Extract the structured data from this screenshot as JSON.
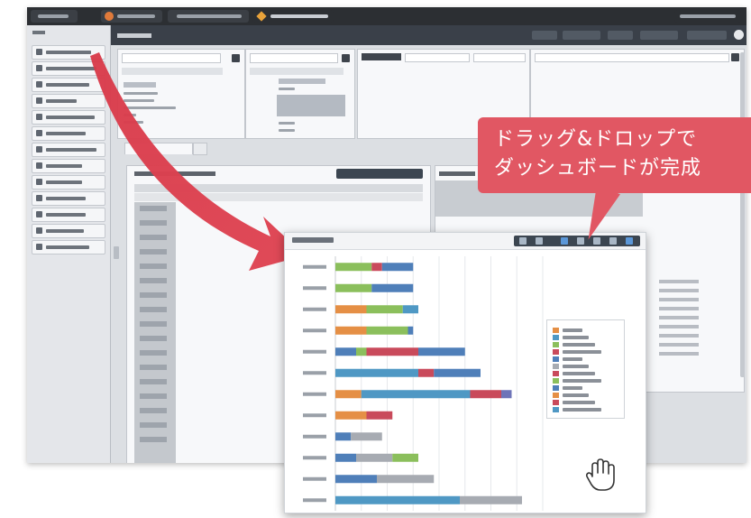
{
  "callout": {
    "line1": "ドラッグ&ドロップで",
    "line2": "ダッシュボードが完成"
  },
  "sidebar": {
    "items": [
      {
        "icon": "chart-icon"
      },
      {
        "icon": "chart-icon"
      },
      {
        "icon": "gauge-icon"
      },
      {
        "icon": "table-icon"
      },
      {
        "icon": "filter-icon"
      },
      {
        "icon": "sort-icon"
      },
      {
        "icon": "grid-icon"
      },
      {
        "icon": "pin-icon"
      },
      {
        "icon": "pie-icon"
      },
      {
        "icon": "line-icon"
      },
      {
        "icon": "line-icon"
      },
      {
        "icon": "link-icon"
      },
      {
        "icon": "map-icon"
      }
    ]
  },
  "colors": {
    "accent": "#e15763",
    "green": "#8bbf5c",
    "red": "#c94a5b",
    "blue": "#4f7fb9",
    "orange": "#e58f45",
    "gray": "#a7abb2",
    "teal": "#4f98c4",
    "purple": "#6e74b8"
  },
  "chart_data": {
    "type": "bar",
    "orientation": "horizontal",
    "stacked": true,
    "x_ticks": [
      "0",
      "5",
      "10",
      "15",
      "20",
      "25",
      "30",
      "35",
      "40"
    ],
    "xlim": [
      0,
      40
    ],
    "grid": true,
    "legend_position": "right",
    "rows": [
      {
        "segments": [
          {
            "color": "green",
            "value": 7
          },
          {
            "color": "red",
            "value": 2
          },
          {
            "color": "blue",
            "value": 6
          }
        ]
      },
      {
        "segments": [
          {
            "color": "green",
            "value": 7
          },
          {
            "color": "blue",
            "value": 8
          }
        ]
      },
      {
        "segments": [
          {
            "color": "orange",
            "value": 6
          },
          {
            "color": "green",
            "value": 7
          },
          {
            "color": "teal",
            "value": 3
          }
        ]
      },
      {
        "segments": [
          {
            "color": "orange",
            "value": 6
          },
          {
            "color": "green",
            "value": 8
          },
          {
            "color": "blue",
            "value": 1
          }
        ]
      },
      {
        "segments": [
          {
            "color": "blue",
            "value": 4
          },
          {
            "color": "green",
            "value": 2
          },
          {
            "color": "red",
            "value": 10
          },
          {
            "color": "blue",
            "value": 9
          }
        ]
      },
      {
        "segments": [
          {
            "color": "teal",
            "value": 16
          },
          {
            "color": "red",
            "value": 3
          },
          {
            "color": "blue",
            "value": 9
          }
        ]
      },
      {
        "segments": [
          {
            "color": "orange",
            "value": 5
          },
          {
            "color": "teal",
            "value": 21
          },
          {
            "color": "red",
            "value": 6
          },
          {
            "color": "purple",
            "value": 2
          }
        ]
      },
      {
        "segments": [
          {
            "color": "orange",
            "value": 6
          },
          {
            "color": "red",
            "value": 5
          }
        ]
      },
      {
        "segments": [
          {
            "color": "blue",
            "value": 3
          },
          {
            "color": "gray",
            "value": 6
          }
        ]
      },
      {
        "segments": [
          {
            "color": "blue",
            "value": 4
          },
          {
            "color": "gray",
            "value": 7
          },
          {
            "color": "green",
            "value": 5
          }
        ]
      },
      {
        "segments": [
          {
            "color": "blue",
            "value": 8
          },
          {
            "color": "gray",
            "value": 11
          }
        ]
      },
      {
        "segments": [
          {
            "color": "teal",
            "value": 24
          },
          {
            "color": "gray",
            "value": 12
          }
        ]
      }
    ],
    "legend_colors": [
      "orange",
      "teal",
      "green",
      "red",
      "blue",
      "gray",
      "red",
      "green",
      "blue",
      "orange",
      "red",
      "teal"
    ]
  }
}
